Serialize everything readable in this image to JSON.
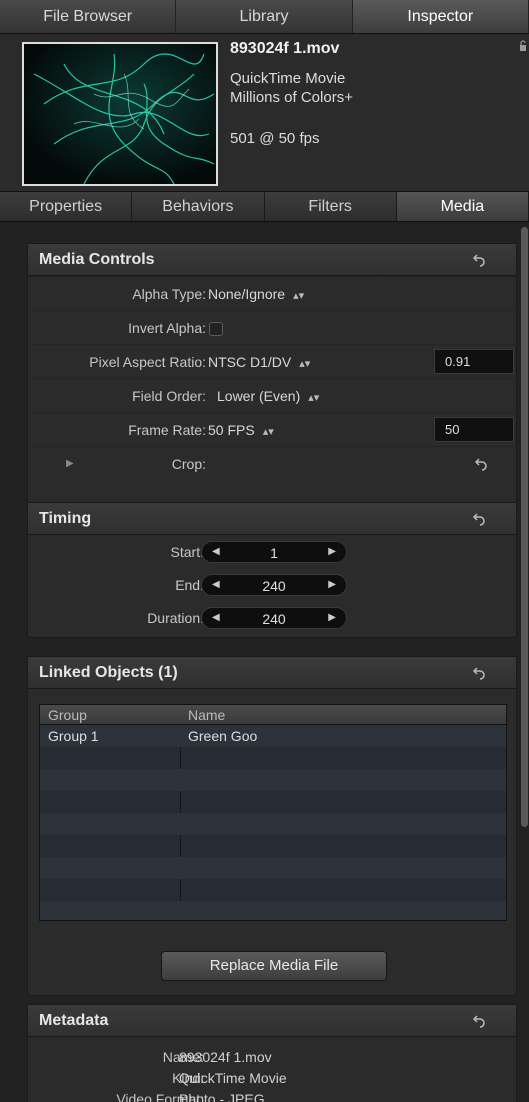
{
  "top_tabs": [
    "File Browser",
    "Library",
    "Inspector"
  ],
  "header": {
    "file_name": "893024f 1.mov",
    "kind": "QuickTime Movie",
    "colors": "Millions of Colors+",
    "rate_info": "501 @ 50 fps"
  },
  "sub_tabs": [
    "Properties",
    "Behaviors",
    "Filters",
    "Media"
  ],
  "media_controls": {
    "title": "Media Controls",
    "alpha_type_label": "Alpha Type:",
    "alpha_type_value": "None/Ignore",
    "invert_alpha_label": "Invert Alpha:",
    "pixel_aspect_label": "Pixel Aspect Ratio:",
    "pixel_aspect_value": "NTSC D1/DV",
    "pixel_aspect_number": "0.91",
    "field_order_label": "Field Order:",
    "field_order_value": "Lower (Even)",
    "frame_rate_label": "Frame Rate:",
    "frame_rate_value": "50 FPS",
    "frame_rate_number": "50",
    "crop_label": "Crop:"
  },
  "timing": {
    "title": "Timing",
    "start_label": "Start:",
    "start_value": "1",
    "end_label": "End:",
    "end_value": "240",
    "duration_label": "Duration:",
    "duration_value": "240"
  },
  "linked_objects": {
    "title": "Linked Objects (1)",
    "columns": [
      "Group",
      "Name"
    ],
    "rows": [
      [
        "Group 1",
        "Green Goo"
      ]
    ],
    "replace_button": "Replace Media File"
  },
  "metadata": {
    "title": "Metadata",
    "name_label": "Name:",
    "name_value": "893024f 1.mov",
    "kind_label": "Kind:",
    "kind_value": "QuickTime Movie",
    "video_format_label": "Video Format:",
    "video_format_value": "Photo - JPEG"
  },
  "icons": {
    "reset": "reset-arrow-icon",
    "lock": "lock-icon",
    "disclosure": "disclosure-triangle-icon",
    "stepper": "popup-arrows-icon"
  },
  "colors": {
    "accent_glow": "#2fe0c0",
    "panel_bg": "#2b2b2b",
    "field_bg": "#101010"
  }
}
